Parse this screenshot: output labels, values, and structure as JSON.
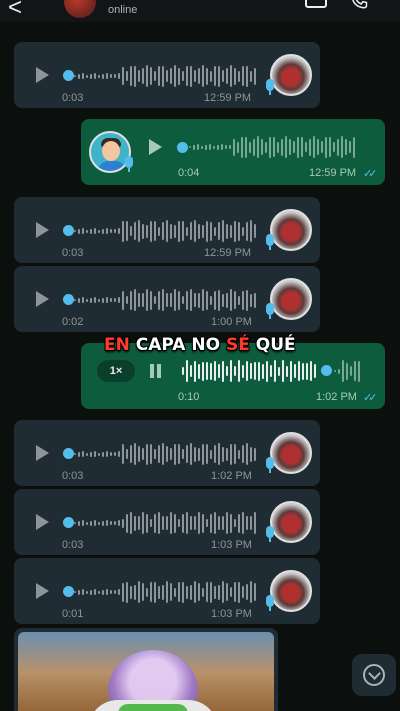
{
  "header": {
    "back_glyph": "<",
    "status": "online",
    "icons": [
      "back-arrow-icon",
      "contact-avatar",
      "video-call-icon",
      "voice-call-icon"
    ]
  },
  "colors": {
    "background": "#0b0f0e",
    "incoming_bubble": "#202c33",
    "outgoing_bubble": "#0d5c3e",
    "accent_blue": "#53bdeb",
    "caption_red": "#ff3b2f"
  },
  "messages": [
    {
      "direction": "incoming",
      "duration": "0:03",
      "time": "12:59 PM"
    },
    {
      "direction": "outgoing",
      "duration": "0:04",
      "time": "12:59 PM",
      "ticks": "✓✓"
    },
    {
      "direction": "incoming",
      "duration": "0:03",
      "time": "12:59 PM"
    },
    {
      "direction": "incoming",
      "duration": "0:02",
      "time": "1:00 PM"
    },
    {
      "direction": "outgoing",
      "duration": "0:10",
      "time": "1:02 PM",
      "ticks": "✓✓",
      "speed": "1×",
      "state": "playing"
    },
    {
      "direction": "incoming",
      "duration": "0:03",
      "time": "1:02 PM"
    },
    {
      "direction": "incoming",
      "duration": "0:03",
      "time": "1:03 PM"
    },
    {
      "direction": "incoming",
      "duration": "0:01",
      "time": "1:03 PM"
    }
  ],
  "caption": {
    "part1": "EN",
    "part2": "CAPA NO",
    "part3": "SÉ",
    "part4": "QUÉ"
  },
  "video_thumbnail": "toy-story-buzz-lightyear-image"
}
